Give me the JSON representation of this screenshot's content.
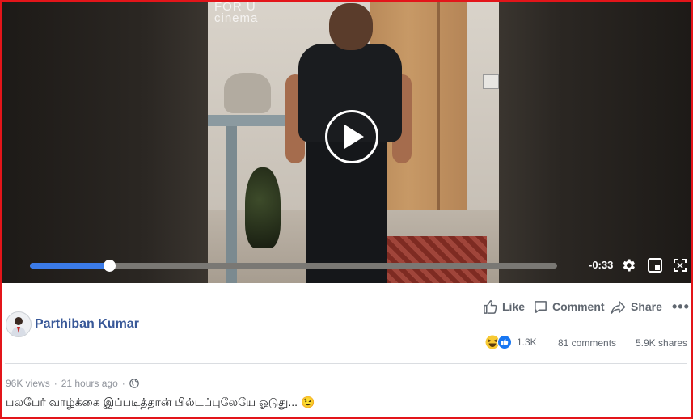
{
  "video": {
    "watermark": "FOR U\ncinema",
    "time_remaining": "-0:33",
    "progress": 0.15,
    "buffered": 0.88,
    "icons": [
      "play-icon",
      "gear-icon",
      "mini-player-icon",
      "fullscreen-icon"
    ]
  },
  "post": {
    "author": "Parthiban Kumar",
    "actions": {
      "like": "Like",
      "comment": "Comment",
      "share": "Share"
    },
    "reaction_count": "1.3K",
    "comments": "81 comments",
    "shares": "5.9K shares",
    "views": "96K views",
    "time": "21 hours ago",
    "separator": "·",
    "caption": "பலபேர் வாழ்க்கை இப்படித்தான் பில்டப்புலேயே ஓடுது... 😉"
  },
  "colors": {
    "accent": "#3b7be8",
    "author_link": "#385898",
    "frame_border": "#e3151a"
  }
}
